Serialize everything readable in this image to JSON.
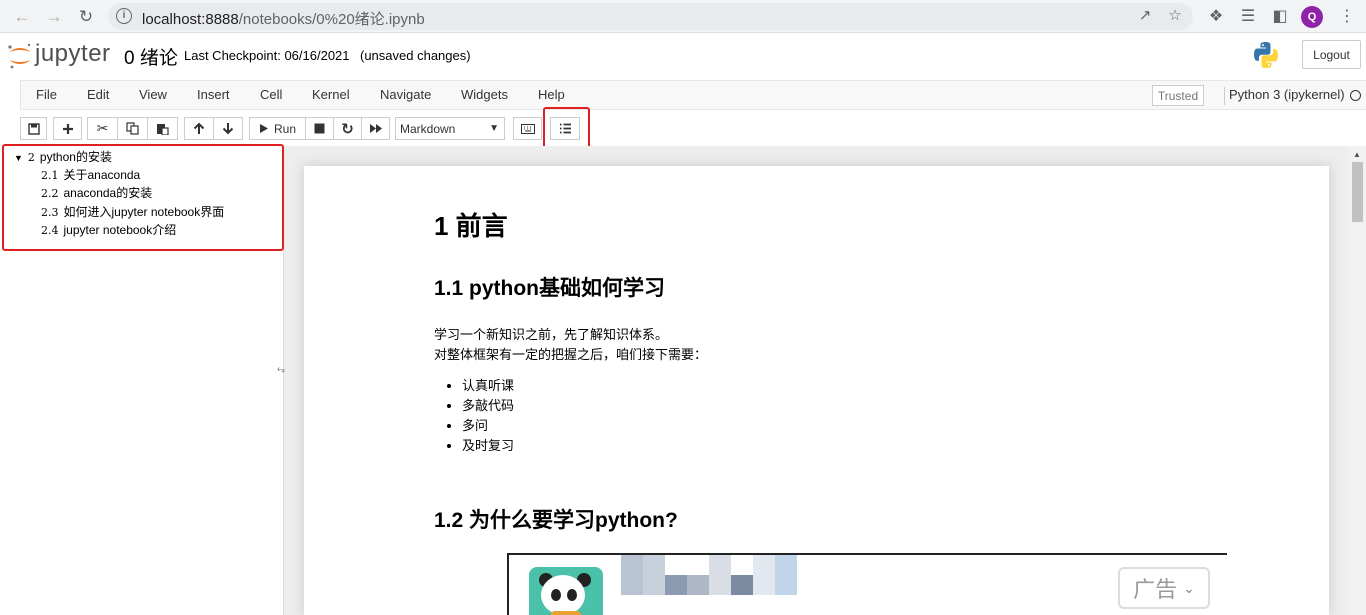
{
  "browser": {
    "url_host": "localhost:8888",
    "url_path": "/notebooks/0%20绪论.ipynb",
    "profile_initial": "Q"
  },
  "header": {
    "logo_text": "jupyter",
    "notebook_name": "0 绪论",
    "checkpoint": "Last Checkpoint: 06/16/2021",
    "unsaved": "(unsaved changes)",
    "logout_label": "Logout"
  },
  "menubar": {
    "items": [
      "File",
      "Edit",
      "View",
      "Insert",
      "Cell",
      "Kernel",
      "Navigate",
      "Widgets",
      "Help"
    ],
    "trusted": "Trusted",
    "kernel": "Python 3 (ipykernel)"
  },
  "toolbar": {
    "run_label": "Run",
    "cell_type": "Markdown"
  },
  "toc": {
    "section": {
      "num": "2",
      "title": "python的安装"
    },
    "items": [
      {
        "num": "2.1",
        "title": "关于anaconda"
      },
      {
        "num": "2.2",
        "title": "anaconda的安装"
      },
      {
        "num": "2.3",
        "title": "如何进入jupyter notebook界面"
      },
      {
        "num": "2.4",
        "title": "jupyter notebook介绍"
      }
    ]
  },
  "notebook": {
    "h1": "1  前言",
    "h2_1": "1.1  python基础如何学习",
    "para_1": "学习一个新知识之前，先了解知识体系。",
    "para_2": "对整体框架有一定的把握之后，咱们接下需要：",
    "bullets": [
      "认真听课",
      "多敲代码",
      "多问",
      "及时复习"
    ],
    "h2_2": "1.2  为什么要学习python?",
    "ad_label": "广告"
  },
  "colors": {
    "highlight_box": "#e02020",
    "jupyter_orange": "#f37726",
    "profile": "#8e24aa"
  }
}
